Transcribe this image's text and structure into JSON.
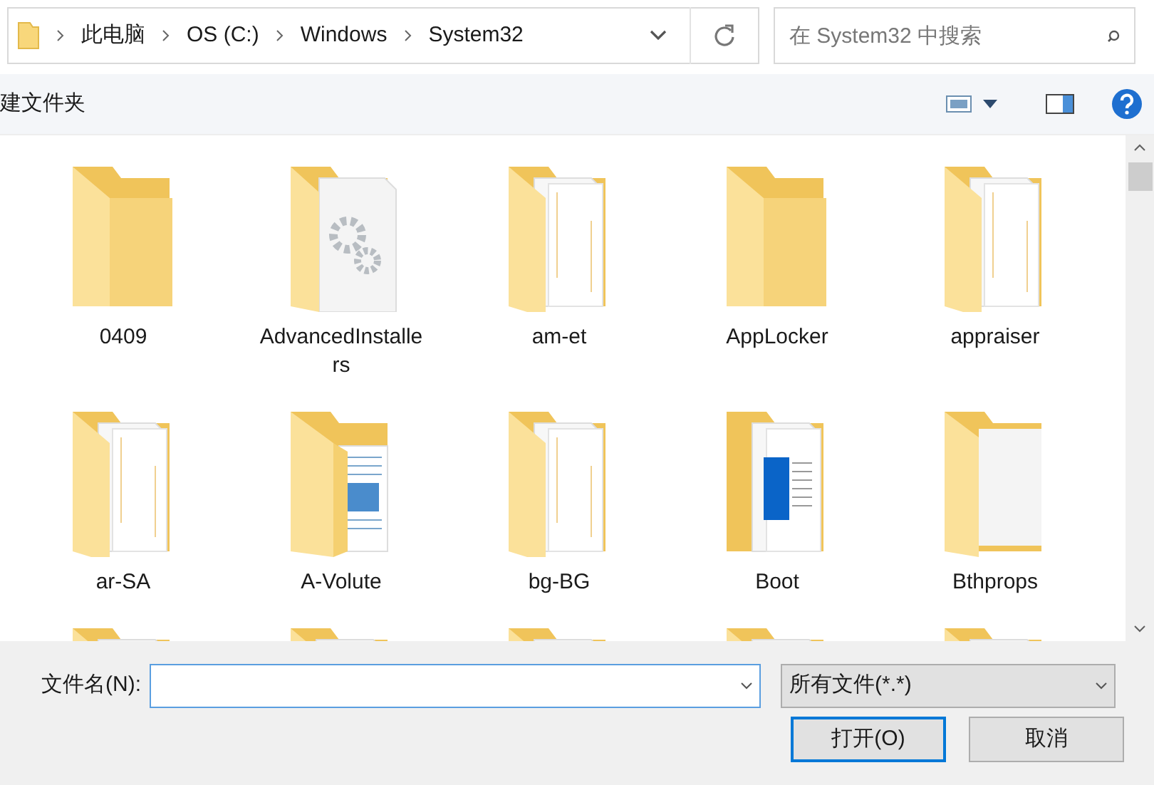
{
  "address_bar": {
    "crumbs": [
      "此电脑",
      "OS (C:)",
      "Windows",
      "System32"
    ]
  },
  "search": {
    "placeholder": "在 System32 中搜索"
  },
  "toolbar": {
    "new_folder": "建文件夹"
  },
  "folders": [
    {
      "label": "0409",
      "kind": "plain"
    },
    {
      "label": "AdvancedInstallers",
      "kind": "gears"
    },
    {
      "label": "am-et",
      "kind": "docs"
    },
    {
      "label": "AppLocker",
      "kind": "plain"
    },
    {
      "label": "appraiser",
      "kind": "docs"
    },
    {
      "label": "ar-SA",
      "kind": "docs"
    },
    {
      "label": "A-Volute",
      "kind": "picture"
    },
    {
      "label": "bg-BG",
      "kind": "docs"
    },
    {
      "label": "Boot",
      "kind": "screen"
    },
    {
      "label": "Bthprops",
      "kind": "page"
    }
  ],
  "partial_folders": [
    {
      "kind": "docs"
    },
    {
      "kind": "docs"
    },
    {
      "kind": "docs"
    },
    {
      "kind": "docs"
    },
    {
      "kind": "docs"
    }
  ],
  "file_name": {
    "label": "文件名(N):"
  },
  "file_type": {
    "value": "所有文件(*.*)"
  },
  "buttons": [
    {
      "label": "打开(O)",
      "default": true
    },
    {
      "label": "取消",
      "default": false
    }
  ]
}
